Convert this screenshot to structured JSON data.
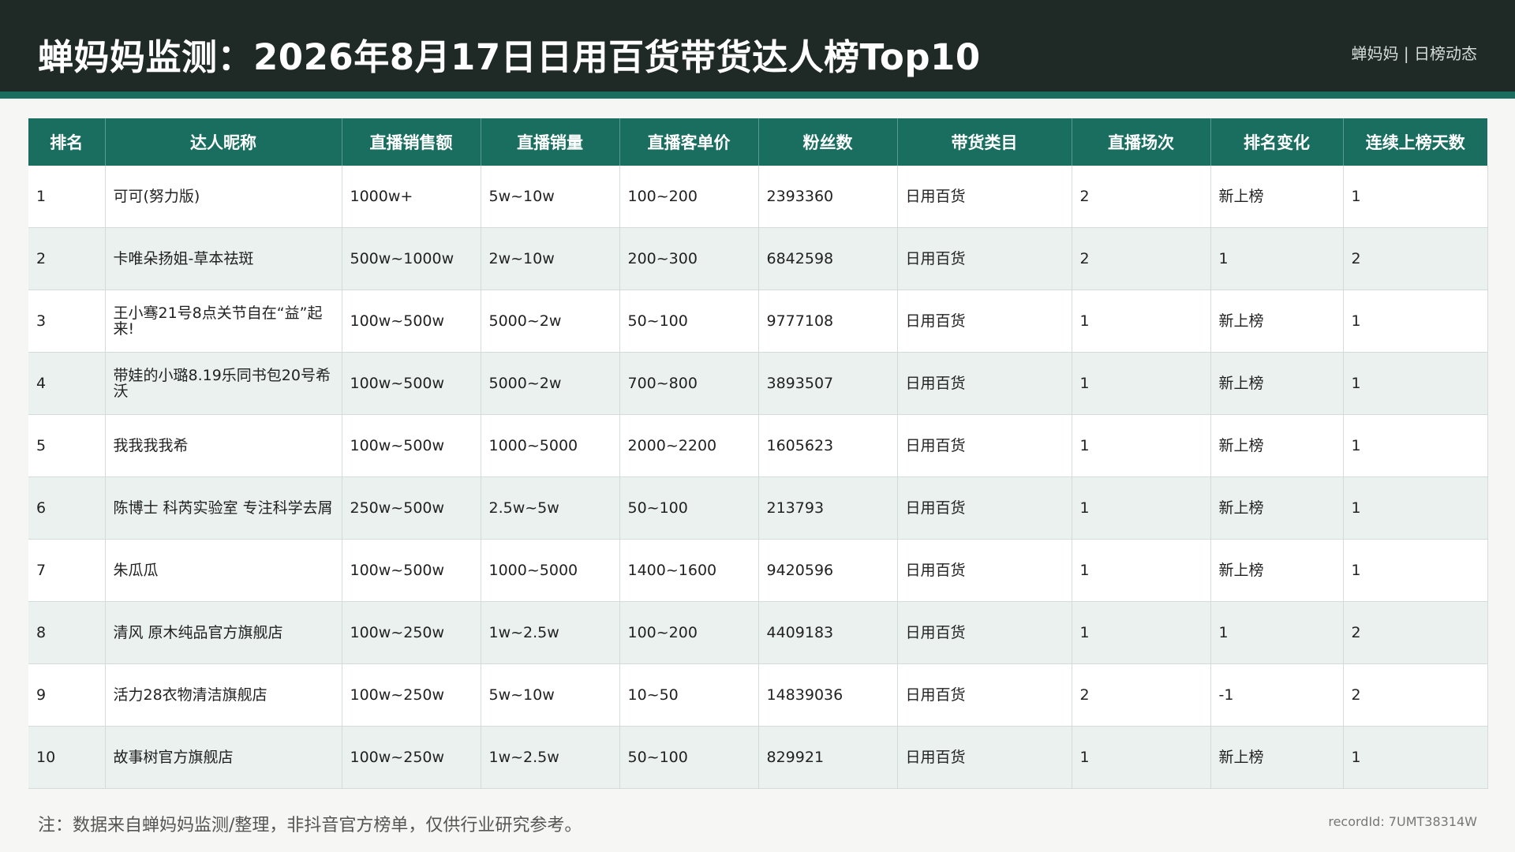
{
  "header": {
    "title": "蝉妈妈监测：2026年8月17日日用百货带货达人榜Top10",
    "brand": "蝉妈妈 | 日榜动态"
  },
  "table": {
    "columns": [
      "排名",
      "达人昵称",
      "直播销售额",
      "直播销量",
      "直播客单价",
      "粉丝数",
      "带货类目",
      "直播场次",
      "排名变化",
      "连续上榜天数"
    ],
    "rows": [
      [
        "1",
        "可可(努力版)",
        "1000w+",
        "5w~10w",
        "100~200",
        "2393360",
        "日用百货",
        "2",
        "新上榜",
        "1"
      ],
      [
        "2",
        "卡唯朵扬姐-草本祛斑",
        "500w~1000w",
        "2w~10w",
        "200~300",
        "6842598",
        "日用百货",
        "2",
        "1",
        "2"
      ],
      [
        "3",
        "王小骞21号8点关节自在“益”起来!",
        "100w~500w",
        "5000~2w",
        "50~100",
        "9777108",
        "日用百货",
        "1",
        "新上榜",
        "1"
      ],
      [
        "4",
        "带娃的小璐8.19乐同书包20号希沃",
        "100w~500w",
        "5000~2w",
        "700~800",
        "3893507",
        "日用百货",
        "1",
        "新上榜",
        "1"
      ],
      [
        "5",
        "我我我我希",
        "100w~500w",
        "1000~5000",
        "2000~2200",
        "1605623",
        "日用百货",
        "1",
        "新上榜",
        "1"
      ],
      [
        "6",
        "陈博士 科芮实验室 专注科学去屑",
        "250w~500w",
        "2.5w~5w",
        "50~100",
        "213793",
        "日用百货",
        "1",
        "新上榜",
        "1"
      ],
      [
        "7",
        "朱瓜瓜",
        "100w~500w",
        "1000~5000",
        "1400~1600",
        "9420596",
        "日用百货",
        "1",
        "新上榜",
        "1"
      ],
      [
        "8",
        "清风 原木纯品官方旗舰店",
        "100w~250w",
        "1w~2.5w",
        "100~200",
        "4409183",
        "日用百货",
        "1",
        "1",
        "2"
      ],
      [
        "9",
        "活力28衣物清洁旗舰店",
        "100w~250w",
        "5w~10w",
        "10~50",
        "14839036",
        "日用百货",
        "2",
        "-1",
        "2"
      ],
      [
        "10",
        "故事树官方旗舰店",
        "100w~250w",
        "1w~2.5w",
        "50~100",
        "829921",
        "日用百货",
        "1",
        "新上榜",
        "1"
      ]
    ]
  },
  "footer": {
    "note": "注：数据来自蝉妈妈监测/整理，非抖音官方榜单，仅供行业研究参考。",
    "record": "recordId: 7UMT38314W"
  }
}
